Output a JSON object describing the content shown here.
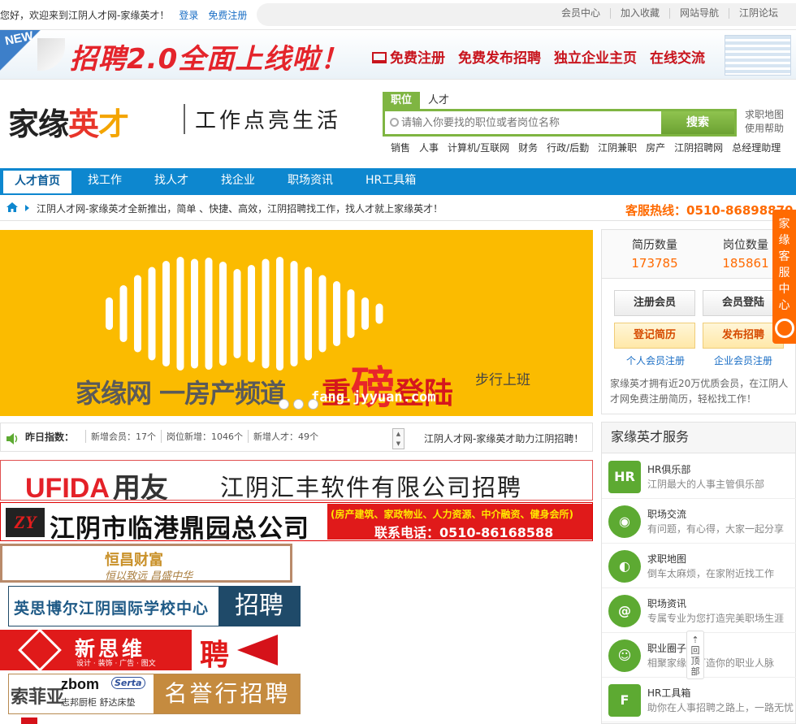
{
  "topbar": {
    "welcome": "您好，欢迎来到江阴人才网-家缘英才！",
    "login": "登录",
    "register": "免费注册",
    "links": [
      "会员中心",
      "加入收藏",
      "网站导航",
      "江阴论坛"
    ]
  },
  "banner": {
    "new_tag": "NEW",
    "headline": "招聘2.0全面上线啦！",
    "features": [
      "免费注册",
      "免费发布招聘",
      "独立企业主页",
      "在线交流"
    ]
  },
  "logo": {
    "part1": "家缘",
    "part2": "英",
    "part3": "才",
    "slogan": "工作点亮生活"
  },
  "search": {
    "tabs": [
      "职位",
      "人才"
    ],
    "placeholder": "请输入你要找的职位或者岗位名称",
    "button": "搜索",
    "side_links": [
      "求职地图",
      "使用帮助"
    ],
    "hot_words": [
      "销售",
      "人事",
      "计算机/互联网",
      "财务",
      "行政/后勤",
      "江阴兼职",
      "房产",
      "江阴招聘网",
      "总经理助理"
    ]
  },
  "nav": {
    "items": [
      "人才首页",
      "找工作",
      "找人才",
      "找企业",
      "职场资讯",
      "HR工具箱"
    ]
  },
  "notice": {
    "text": "江阴人才网-家缘英才全新推出，简单 、快捷、高效，江阴招聘找工作，找人才就上家缘英才！",
    "hotline": "客服热线：0510-86898870"
  },
  "hero": {
    "brand": "家缘网 一房产频道",
    "heavy_pre": "重",
    "heavy_big": "磅",
    "heavy_post": "登陆",
    "walk": "步行上班",
    "url": "fang.jyyuan.com"
  },
  "stats": {
    "label": "昨日指数：",
    "values": [
      "新增会员：17个",
      "岗位新增：1046个",
      "新增人才：49个"
    ],
    "scroll_text": "江阴人才网-家缘英才助力江阴招聘！"
  },
  "ads": {
    "ufida_en": "UFIDA",
    "ufida_cn": "用友",
    "ufida_company": "江阴汇丰软件有限公司招聘",
    "zy_mark": "ZY",
    "zy_company": "江阴市临港鼎园总公司",
    "zy_services": "(房产建筑、家政物业、人力资源、中介融资、健身会所)",
    "zy_phone": "联系电话：0510-86168588",
    "hc_name": "恒昌财富",
    "hc_slogan": "恒以致远 昌盛中华",
    "school_name": "英思博尔江阴国际学校中心",
    "school_tag": "招聘",
    "xsw_name": "新思维",
    "xsw_sub": "设计 · 装饰 · 广告 · 图文",
    "xsw_tag": "聘",
    "mc_brand1": "索菲亚",
    "mc_brand2": "zbom",
    "mc_brand2_sub": "志邦厨柜 舒达床垫",
    "mc_serta": "Serta",
    "mc_tag": "名誉行招聘"
  },
  "side": {
    "resume_label": "简历数量",
    "resume_count": "173785",
    "job_label": "岗位数量",
    "job_count": "185861",
    "register_btn": "注册会员",
    "login_btn": "会员登陆",
    "resume_btn": "登记简历",
    "post_btn": "发布招聘",
    "personal_link": "个人会员注册",
    "company_link": "企业会员注册",
    "desc": "家缘英才拥有近20万优质会员，在江阴人才网免费注册简历，轻松找工作！"
  },
  "service": {
    "title": "家缘英才服务",
    "items": [
      {
        "title": "HR俱乐部",
        "desc": "江阴最大的人事主管俱乐部",
        "icon": "HR"
      },
      {
        "title": "职场交流",
        "desc": "有问题，有心得，大家一起分享",
        "icon": "◉"
      },
      {
        "title": "求职地图",
        "desc": "倒车太麻烦，在家附近找工作",
        "icon": "◐"
      },
      {
        "title": "职场资讯",
        "desc": "专属专业为您打造完美职场生涯",
        "icon": "@"
      },
      {
        "title": "职业圈子",
        "desc": "相聚家缘，打造你的职业人脉",
        "icon": "☺"
      },
      {
        "title": "HR工具箱",
        "desc": "助你在人事招聘之路上，一路无忧",
        "icon": "F"
      }
    ]
  },
  "float": {
    "kefu": "家缘客服中心",
    "backtop": "回顶部"
  }
}
